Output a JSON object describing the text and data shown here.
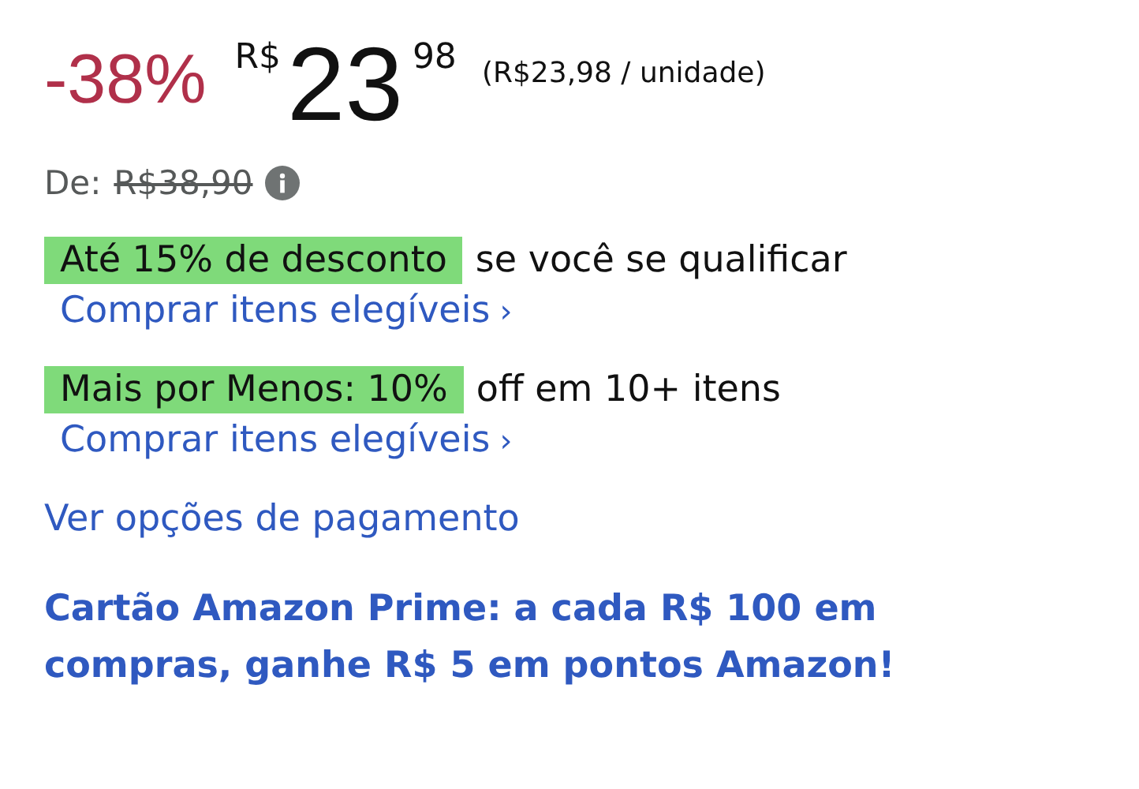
{
  "price": {
    "discount": "-38%",
    "currency": "R$",
    "whole": "23",
    "fraction": "98",
    "unit_price": "(R$23,98 / unidade)"
  },
  "list_price": {
    "label": "De:",
    "value": "R$38,90"
  },
  "promotions": [
    {
      "badge": "Até 15% de desconto",
      "text": "se você se qualificar",
      "link": "Comprar itens elegíveis",
      "chevron": "›"
    },
    {
      "badge": "Mais por Menos: 10%",
      "text": "off em 10+ itens",
      "link": "Comprar itens elegíveis",
      "chevron": "›"
    }
  ],
  "payment_link": "Ver opções de pagamento",
  "card_offer": "Cartão Amazon Prime: a cada R$ 100 em compras, ganhe R$ 5 em pontos Amazon!"
}
